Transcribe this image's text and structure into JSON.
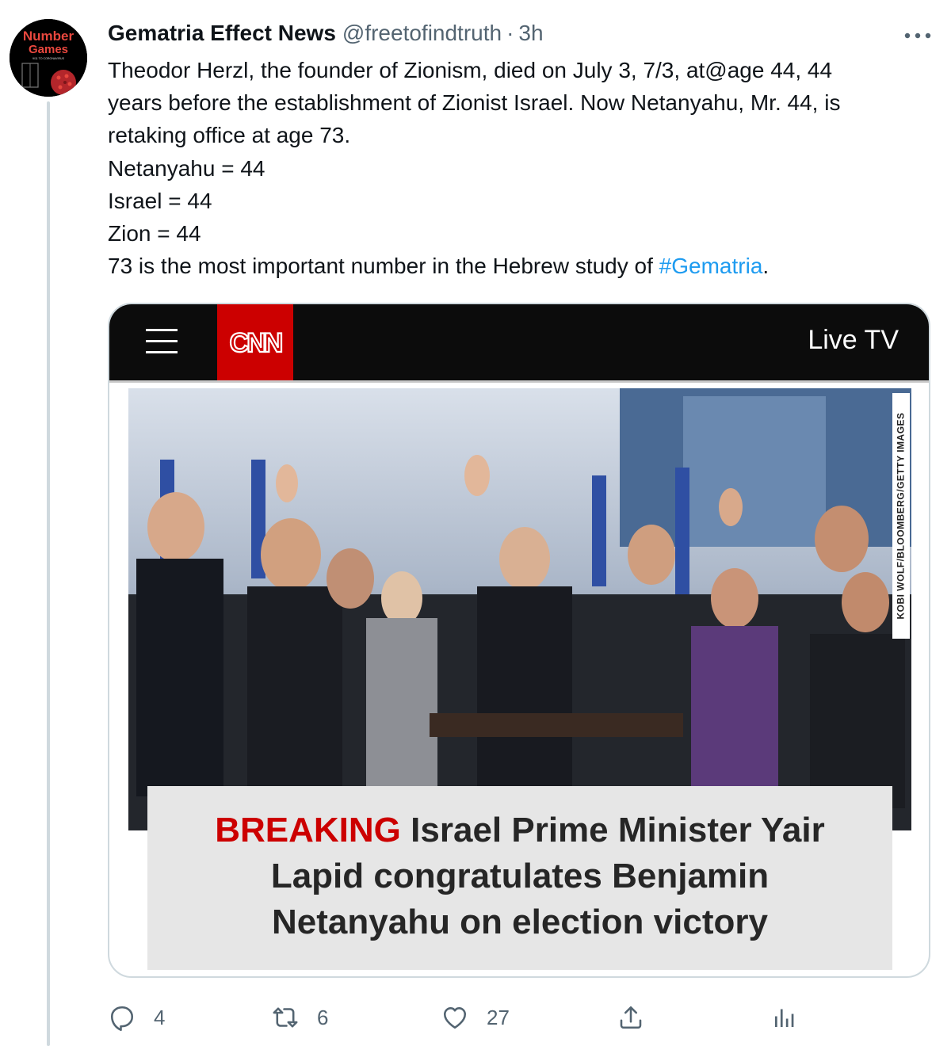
{
  "author": {
    "display_name": "Gematria Effect News",
    "handle": "@freetofindtruth",
    "separator": "·",
    "time": "3h",
    "avatar": {
      "line1": "Number",
      "line2": "Games",
      "tagline": "9/11 TO CORONAVIRUS"
    }
  },
  "tweet": {
    "lines": [
      "Theodor Herzl, the founder of Zionism, died on July 3, 7/3, at@age 44, 44",
      "years before the establishment of Zionist Israel. Now Netanyahu, Mr. 44, is",
      "retaking office at age 73.",
      "Netanyahu = 44",
      "Israel = 44",
      "Zion = 44"
    ],
    "last_line_prefix": "73 is the most important number in the Hebrew study of ",
    "hashtag": "#Gematria",
    "last_line_suffix": "."
  },
  "media": {
    "brand": "CNN",
    "nav_right": "Live TV",
    "photo_credit": "KOBI WOLF/BLOOMBERG/GETTY IMAGES",
    "headline_label": "BREAKING",
    "headline_lines": [
      "Israel Prime Minister Yair",
      "Lapid congratulates Benjamin",
      "Netanyahu on election victory"
    ]
  },
  "actions": {
    "replies": "4",
    "retweets": "6",
    "likes": "27"
  },
  "colors": {
    "link": "#1d9bf0",
    "cnn_red": "#cc0000",
    "muted": "#536471",
    "text": "#0f1419"
  },
  "icons": [
    "more-icon",
    "menu-icon",
    "reply-icon",
    "retweet-icon",
    "like-icon",
    "share-icon",
    "analytics-icon"
  ]
}
